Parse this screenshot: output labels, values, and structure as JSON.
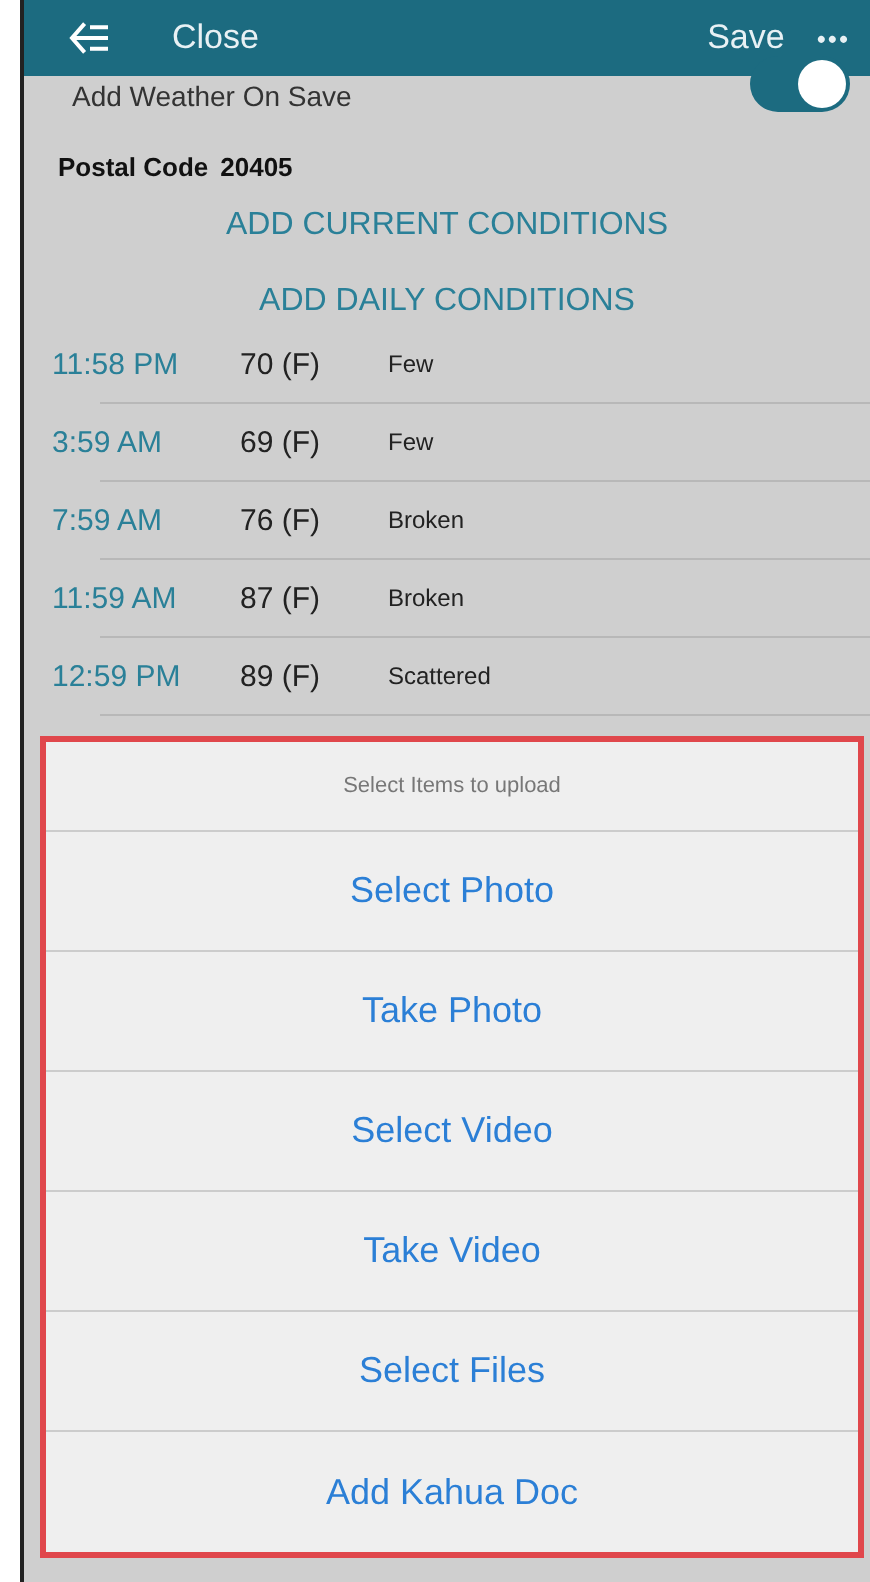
{
  "header": {
    "back_label": "Close",
    "save_label": "Save",
    "more": "•••"
  },
  "weather_toggle": {
    "label": "Add Weather On Save",
    "on": true
  },
  "postal": {
    "label": "Postal Code",
    "value": "20405"
  },
  "actions": [
    "ADD CURRENT CONDITIONS",
    "ADD DAILY CONDITIONS"
  ],
  "conditions": [
    {
      "time": "11:58 PM",
      "temp": "70 (F)",
      "sky": "Few"
    },
    {
      "time": "3:59 AM",
      "temp": "69 (F)",
      "sky": "Few"
    },
    {
      "time": "7:59 AM",
      "temp": "76 (F)",
      "sky": "Broken"
    },
    {
      "time": "11:59 AM",
      "temp": "87 (F)",
      "sky": "Broken"
    },
    {
      "time": "12:59 PM",
      "temp": "89 (F)",
      "sky": "Scattered"
    }
  ],
  "upload_sheet": {
    "title": "Select Items to upload",
    "options": [
      "Select Photo",
      "Take Photo",
      "Select Video",
      "Take Video",
      "Select Files",
      "Add Kahua Doc"
    ]
  }
}
